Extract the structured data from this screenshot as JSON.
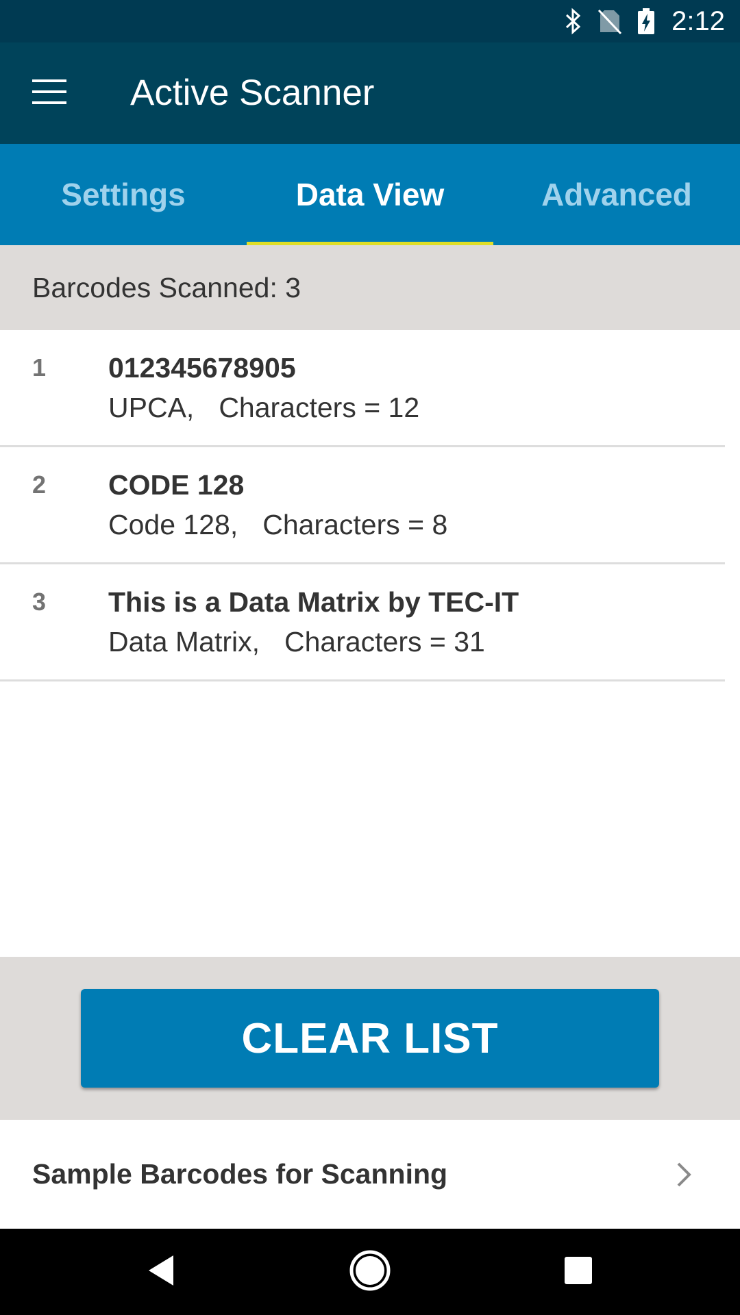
{
  "status_bar": {
    "time": "2:12",
    "icons": [
      "bluetooth-icon",
      "no-sim-icon",
      "battery-charging-icon"
    ]
  },
  "app_bar": {
    "title": "Active Scanner",
    "menu_icon": "hamburger-menu-icon"
  },
  "tabs": [
    {
      "label": "Settings",
      "active": false
    },
    {
      "label": "Data View",
      "active": true
    },
    {
      "label": "Advanced",
      "active": false
    }
  ],
  "summary": {
    "text": "Barcodes Scanned: 3"
  },
  "barcodes": [
    {
      "index": "1",
      "data": "012345678905",
      "symbology": "UPCA,",
      "characters": "Characters = 12"
    },
    {
      "index": "2",
      "data": "CODE 128",
      "symbology": "Code 128,",
      "characters": "Characters = 8"
    },
    {
      "index": "3",
      "data": "This is a Data Matrix by TEC-IT",
      "symbology": "Data Matrix,",
      "characters": "Characters = 31"
    }
  ],
  "clear_button": {
    "label": "CLEAR LIST"
  },
  "sample_row": {
    "label": "Sample Barcodes for Scanning",
    "icon": "chevron-right-icon"
  },
  "nav_bar": {
    "icons": [
      "back-icon",
      "home-icon",
      "recents-icon"
    ]
  },
  "colors": {
    "status_bar": "#003a52",
    "app_bar": "#00435a",
    "tabs": "#007cb4",
    "tab_indicator": "#e0de27",
    "summary_bg": "#dedbd9",
    "button": "#007cb4"
  }
}
